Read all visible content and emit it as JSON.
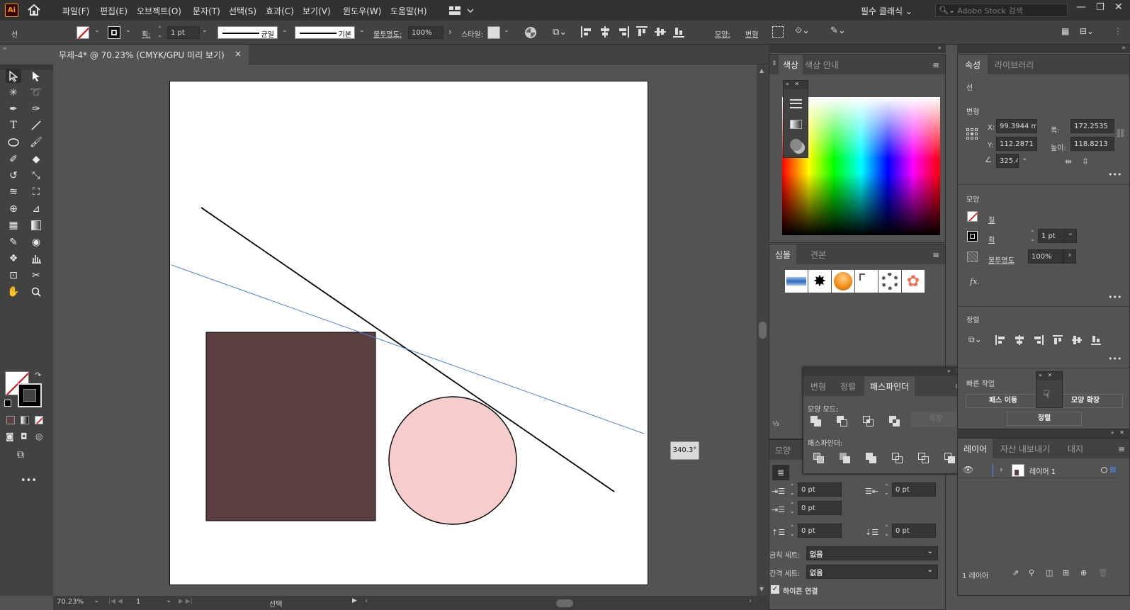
{
  "app": {
    "logo": "Ai"
  },
  "menu": [
    "파일(F)",
    "편집(E)",
    "오브젝트(O)",
    "문자(T)",
    "선택(S)",
    "효과(C)",
    "보기(V)",
    "윈도우(W)",
    "도움말(H)"
  ],
  "workspace": {
    "label": "필수 클래식",
    "search_placeholder": "Adobe Stock 검색"
  },
  "control": {
    "object_label": "선",
    "stroke_label": "획:",
    "stroke_weight": "1 pt",
    "profile_uniform": "균일",
    "brush_basic": "기본",
    "opacity_label": "불투명도:",
    "opacity": "100%",
    "style_label": "스타일:",
    "shape_label": "모양:",
    "transform_label": "변형"
  },
  "document": {
    "tab_title": "무제-4* @ 70.23% (CMYK/GPU 미리 보기)",
    "close": "×"
  },
  "canvas": {
    "angle_tooltip": "340.3°",
    "line_color": "#000000",
    "guide_color": "#4a7fd4",
    "rect_fill": "#5a3e40",
    "circle_fill": "#f7cccc"
  },
  "status": {
    "zoom": "70.23%",
    "page": "1",
    "mode": "선택"
  },
  "color_panel": {
    "tabs": [
      "색상",
      "색상 안내"
    ]
  },
  "symbol_panel": {
    "tabs": [
      "심볼",
      "견본"
    ]
  },
  "pathfinder_panel": {
    "tabs": [
      "변형",
      "정렬",
      "패스파인더"
    ],
    "shape_modes_label": "모양 모드:",
    "expand_label": "확장",
    "pathfinders_label": "패스파인더:"
  },
  "paragraph_panel": {
    "tab_partial": "모양",
    "indent_left": "0 pt",
    "indent_right": "0 pt",
    "indent_first": "0 pt",
    "space_before": "0 pt",
    "space_after": "0 pt",
    "kinsoku_label": "금칙 세트:",
    "kinsoku_value": "없음",
    "mojikumi_label": "간격 세트:",
    "mojikumi_value": "없음",
    "hyphenate_label": "하이픈 연결"
  },
  "properties_panel": {
    "tabs": [
      "속성",
      "라이브러리"
    ],
    "object": "선",
    "transform_title": "변형",
    "x_label": "X:",
    "x_value": "99.3944 m",
    "y_label": "Y:",
    "y_value": "112.2871",
    "w_label": "폭:",
    "w_value": "172.2535",
    "h_label": "높이:",
    "h_value": "118.8213",
    "angle_value": "325.40",
    "appearance_title": "모양",
    "fill_label": "칠",
    "stroke_label": "획",
    "stroke_weight": "1 pt",
    "opacity_label": "불투명도",
    "opacity": "100%",
    "fx": "fx.",
    "align_title": "정렬",
    "quick_actions_title": "빠른 작업",
    "offset_path_button": "패스 이동",
    "expand_appearance_button": "모양 확장",
    "hidden_button_partial": "정렬"
  },
  "layers_panel": {
    "tabs": [
      "레이어",
      "자산 내보내기",
      "대지"
    ],
    "layer_name": "레이어 1",
    "footer_count": "1 레이어",
    "highlight_color": "#4b6eaf"
  }
}
